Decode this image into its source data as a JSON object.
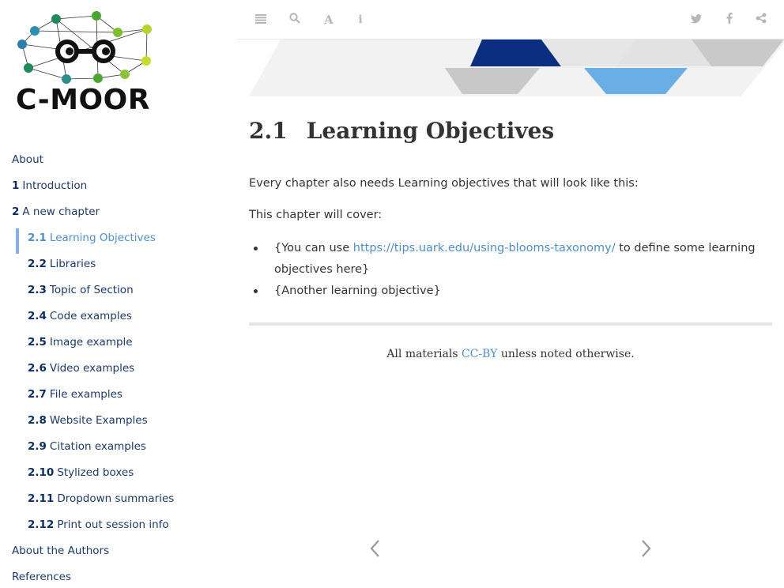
{
  "logo": {
    "text": "C-MOOR"
  },
  "toolbar": {
    "icons": [
      "menu-icon",
      "search-icon",
      "font-icon",
      "info-icon",
      "twitter-icon",
      "facebook-icon",
      "share-icon"
    ]
  },
  "toc": [
    {
      "num": "",
      "label": "About",
      "level": 1
    },
    {
      "num": "1",
      "label": "Introduction",
      "level": 1
    },
    {
      "num": "2",
      "label": "A new chapter",
      "level": 1
    },
    {
      "num": "2.1",
      "label": "Learning Objectives",
      "level": 2,
      "active": true
    },
    {
      "num": "2.2",
      "label": "Libraries",
      "level": 2
    },
    {
      "num": "2.3",
      "label": "Topic of Section",
      "level": 2
    },
    {
      "num": "2.4",
      "label": "Code examples",
      "level": 2
    },
    {
      "num": "2.5",
      "label": "Image example",
      "level": 2
    },
    {
      "num": "2.6",
      "label": "Video examples",
      "level": 2
    },
    {
      "num": "2.7",
      "label": "File examples",
      "level": 2
    },
    {
      "num": "2.8",
      "label": "Website Examples",
      "level": 2
    },
    {
      "num": "2.9",
      "label": "Citation examples",
      "level": 2
    },
    {
      "num": "2.10",
      "label": "Stylized boxes",
      "level": 2
    },
    {
      "num": "2.11",
      "label": "Dropdown summaries",
      "level": 2
    },
    {
      "num": "2.12",
      "label": "Print out session info",
      "level": 2
    },
    {
      "num": "",
      "label": "About the Authors",
      "level": 1
    },
    {
      "num": "",
      "label": "References",
      "level": 1
    }
  ],
  "content": {
    "section_number": "2.1",
    "section_title": "Learning Objectives",
    "intro": "Every chapter also needs Learning objectives that will look like this:",
    "cover": "This chapter will cover:",
    "bullet1_pre": "{You can use ",
    "bullet1_link": "https://tips.uark.edu/using-blooms-taxonomy/",
    "bullet1_post": " to define some learning objectives here}",
    "bullet2": "{Another learning objective}"
  },
  "footer": {
    "pre": "All materials ",
    "link": "CC-BY",
    "post": " unless noted otherwise."
  },
  "nav": {
    "prev_icon": "chevron-left-icon",
    "next_icon": "chevron-right-icon"
  },
  "colors": {
    "toc_text": "#1a3a6e",
    "active": "#4b8fd4",
    "banner_dark_blue": "#0b2e80",
    "banner_light_blue": "#6aaee6",
    "banner_gray": "#c8c8c8"
  }
}
